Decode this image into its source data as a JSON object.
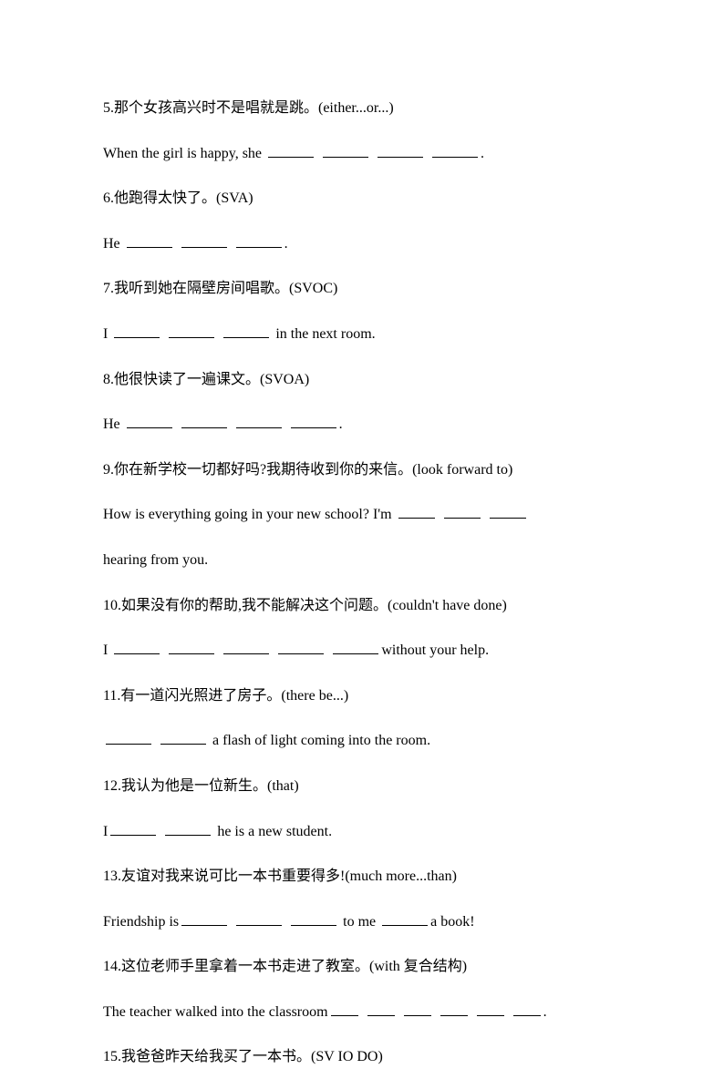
{
  "q5": {
    "prompt": "5.那个女孩高兴时不是唱就是跳。(either...or...)",
    "pre": "When the girl is happy, she ",
    "post": "."
  },
  "q6": {
    "prompt": "6.他跑得太快了。(SVA)",
    "pre": "He ",
    "post": "."
  },
  "q7": {
    "prompt": "7.我听到她在隔壁房间唱歌。(SVOC)",
    "pre": "I ",
    "post": " in the next room."
  },
  "q8": {
    "prompt": "8.他很快读了一遍课文。(SVOA)",
    "pre": "He ",
    "post": "."
  },
  "q9": {
    "prompt": "9.你在新学校一切都好吗?我期待收到你的来信。(look forward to)",
    "pre": "How is everything going in your new school? I'm ",
    "line2": "hearing from you."
  },
  "q10": {
    "prompt": "10.如果没有你的帮助,我不能解决这个问题。(couldn't have done)",
    "pre": "I ",
    "post": "without your help."
  },
  "q11": {
    "prompt": "11.有一道闪光照进了房子。(there be...)",
    "post": " a flash of light coming into the room."
  },
  "q12": {
    "prompt": "12.我认为他是一位新生。(that)",
    "pre": "I",
    "post": " he is a new student."
  },
  "q13": {
    "prompt": "13.友谊对我来说可比一本书重要得多!(much more...than)",
    "pre": "Friendship is",
    "mid": " to me ",
    "post": "a book!"
  },
  "q14": {
    "prompt": "14.这位老师手里拿着一本书走进了教室。(with 复合结构)",
    "pre": "The teacher walked into the classroom",
    "post": "."
  },
  "q15": {
    "prompt": "15.我爸爸昨天给我买了一本书。(SV IO DO)"
  }
}
